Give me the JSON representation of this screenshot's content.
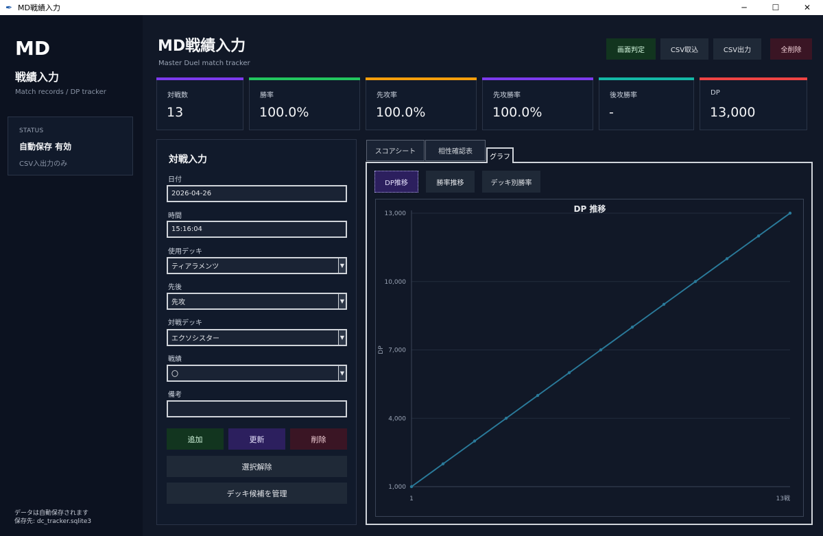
{
  "window": {
    "title": "MD戦績入力",
    "minimize": "─",
    "maximize": "☐",
    "close": "✕"
  },
  "sidebar": {
    "logo": "MD",
    "title": "戦績入力",
    "subtitle": "Match records / DP tracker",
    "status": {
      "heading": "STATUS",
      "value": "自動保存 有効",
      "note": "CSV入出力のみ"
    },
    "footer_line1": "データは自動保存されます",
    "footer_line2": "保存先: dc_tracker.sqlite3"
  },
  "header": {
    "title": "MD戦績入力",
    "subtitle": "Master Duel match tracker",
    "buttons": {
      "screen_judge": "画面判定",
      "csv_import": "CSV取込",
      "csv_export": "CSV出力",
      "delete_all": "全削除"
    }
  },
  "stats": [
    {
      "label": "対戦数",
      "value": "13",
      "color": "#7c3aed"
    },
    {
      "label": "勝率",
      "value": "100.0%",
      "color": "#22c55e"
    },
    {
      "label": "先攻率",
      "value": "100.0%",
      "color": "#f59e0b"
    },
    {
      "label": "先攻勝率",
      "value": "100.0%",
      "color": "#7c3aed"
    },
    {
      "label": "後攻勝率",
      "value": "-",
      "color": "#14b8a6"
    },
    {
      "label": "DP",
      "value": "13,000",
      "color": "#ef4444"
    }
  ],
  "form": {
    "title": "対戦入力",
    "date": {
      "label": "日付",
      "value": "2026-04-26"
    },
    "time": {
      "label": "時間",
      "value": "15:16:04"
    },
    "deck": {
      "label": "使用デッキ",
      "value": "ティアラメンツ"
    },
    "turn": {
      "label": "先後",
      "value": "先攻"
    },
    "opponent": {
      "label": "対戦デッキ",
      "value": "エクソシスター"
    },
    "result": {
      "label": "戦績",
      "value": "〇"
    },
    "memo": {
      "label": "備考",
      "value": ""
    },
    "buttons": {
      "add": "追加",
      "update": "更新",
      "delete": "削除",
      "deselect": "選択解除",
      "manage_decks": "デッキ候補を管理"
    },
    "dropdown_arrow": "▼"
  },
  "tabs": [
    {
      "label": "スコアシート",
      "active": false
    },
    {
      "label": "相性確認表",
      "active": false
    },
    {
      "label": "グラフ",
      "active": true
    }
  ],
  "graph_buttons": [
    {
      "label": "DP推移",
      "active": true
    },
    {
      "label": "勝率推移",
      "active": false
    },
    {
      "label": "デッキ別勝率",
      "active": false
    }
  ],
  "chart_data": {
    "type": "line",
    "title": "DP 推移",
    "xlabel": "",
    "ylabel": "DP",
    "x_tick_labels": [
      "1",
      "13戦"
    ],
    "xlim": [
      1,
      13
    ],
    "ylim": [
      1000,
      13000
    ],
    "y_ticks": [
      1000,
      4000,
      7000,
      10000,
      13000
    ],
    "y_tick_labels": [
      "1,000",
      "4,000",
      "7,000",
      "10,000",
      "13,000"
    ],
    "grid": true,
    "x": [
      1,
      2,
      3,
      4,
      5,
      6,
      7,
      8,
      9,
      10,
      11,
      12,
      13
    ],
    "series": [
      {
        "values": [
          1000,
          2000,
          3000,
          4000,
          5000,
          6000,
          7000,
          8000,
          9000,
          10000,
          11000,
          12000,
          13000
        ],
        "color": "#2a7a9a"
      }
    ]
  }
}
